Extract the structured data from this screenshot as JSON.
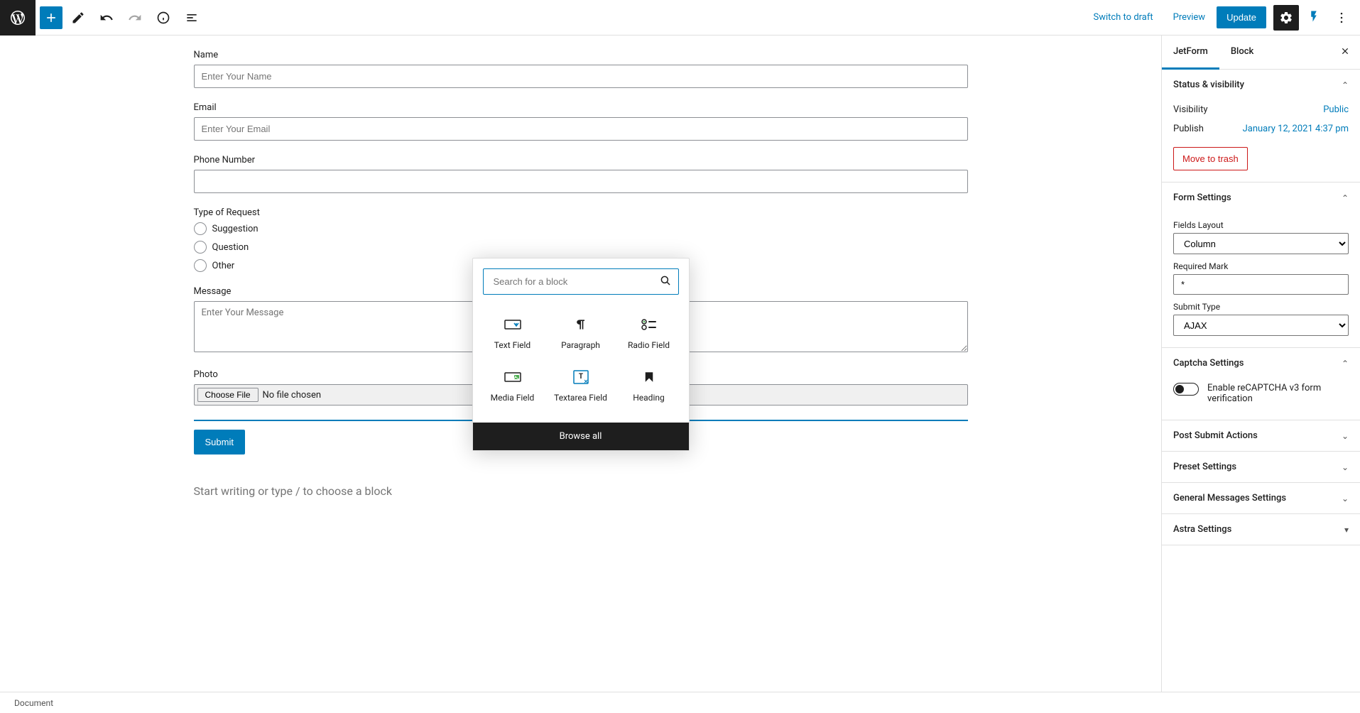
{
  "toolbar": {
    "switch_to_draft": "Switch to draft",
    "preview": "Preview",
    "update": "Update"
  },
  "form": {
    "name": {
      "label": "Name",
      "placeholder": "Enter Your Name"
    },
    "email": {
      "label": "Email",
      "placeholder": "Enter Your Email"
    },
    "phone": {
      "label": "Phone Number",
      "placeholder": ""
    },
    "request_type": {
      "label": "Type of Request",
      "options": [
        "Suggestion",
        "Question",
        "Other"
      ]
    },
    "message": {
      "label": "Message",
      "placeholder": "Enter Your Message"
    },
    "photo": {
      "label": "Photo",
      "choose_file": "Choose File",
      "no_file": "No file chosen"
    },
    "submit": "Submit",
    "placeholder_text": "Start writing or type / to choose a block"
  },
  "inserter": {
    "search_placeholder": "Search for a block",
    "blocks": [
      {
        "label": "Text Field"
      },
      {
        "label": "Paragraph"
      },
      {
        "label": "Radio Field"
      },
      {
        "label": "Media Field"
      },
      {
        "label": "Textarea Field"
      },
      {
        "label": "Heading"
      }
    ],
    "browse_all": "Browse all"
  },
  "sidebar": {
    "tabs": {
      "jetform": "JetForm",
      "block": "Block"
    },
    "status": {
      "title": "Status & visibility",
      "visibility_label": "Visibility",
      "visibility_value": "Public",
      "publish_label": "Publish",
      "publish_value": "January 12, 2021 4:37 pm",
      "trash": "Move to trash"
    },
    "form_settings": {
      "title": "Form Settings",
      "fields_layout_label": "Fields Layout",
      "fields_layout_value": "Column",
      "required_mark_label": "Required Mark",
      "required_mark_value": "*",
      "submit_type_label": "Submit Type",
      "submit_type_value": "AJAX"
    },
    "captcha": {
      "title": "Captcha Settings",
      "toggle_label": "Enable reCAPTCHA v3 form verification"
    },
    "post_submit": {
      "title": "Post Submit Actions"
    },
    "preset": {
      "title": "Preset Settings"
    },
    "general_messages": {
      "title": "General Messages Settings"
    },
    "astra": {
      "title": "Astra Settings"
    }
  },
  "footer": {
    "breadcrumb": "Document"
  }
}
